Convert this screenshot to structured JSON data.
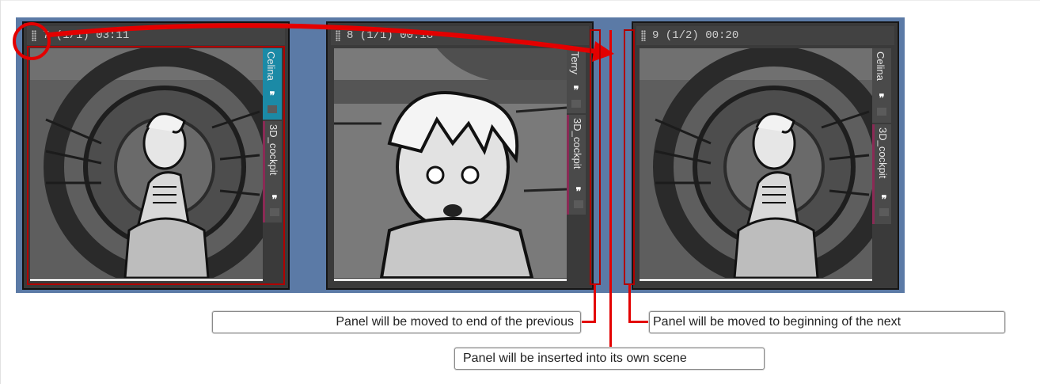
{
  "panels": [
    {
      "header": "7 (1/1) 03:11",
      "tracks": [
        {
          "name": "Celina",
          "color": "#1b8aa6"
        },
        {
          "name": "3D_cockpit",
          "color": "#8a2a55"
        }
      ]
    },
    {
      "header": "8 (1/1) 00:18",
      "tracks": [
        {
          "name": "Terry",
          "color": "#4a4a4a"
        },
        {
          "name": "3D_cockpit",
          "color": "#8a2a55"
        }
      ]
    },
    {
      "header": "9 (1/2) 00:20",
      "tracks": [
        {
          "name": "Celina",
          "color": "#4a4a4a"
        },
        {
          "name": "3D_cockpit",
          "color": "#8a2a55"
        }
      ]
    }
  ],
  "audio_icon": "speech-marks-icon",
  "callouts": {
    "end_of_previous": "Panel will be moved to end of the previous",
    "own_scene": "Panel will be inserted into its own scene",
    "beginning_of_next": "Panel will be moved to beginning of the next"
  },
  "colors": {
    "strip_bg": "#5b7aa6",
    "annotation_red": "#e30000",
    "track_teal": "#1b8aa6",
    "track_maroon": "#8a2a55"
  }
}
